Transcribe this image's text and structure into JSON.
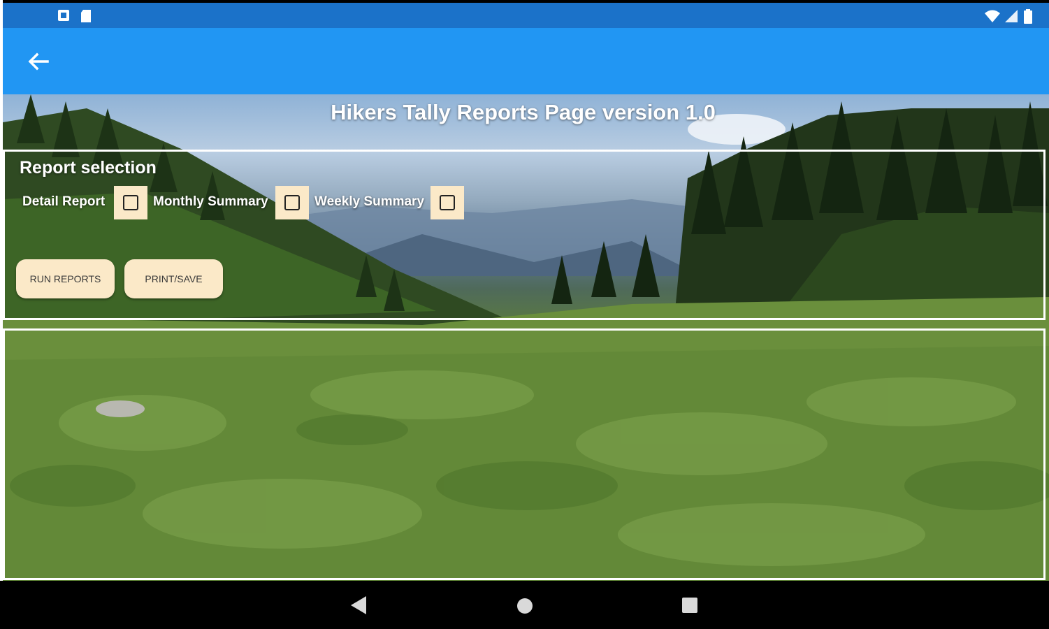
{
  "page": {
    "title": "Hikers Tally Reports Page version 1.0"
  },
  "report_selection": {
    "heading": "Report selection",
    "options": [
      {
        "label": "Detail Report",
        "checked": false
      },
      {
        "label": "Monthly Summary",
        "checked": false
      },
      {
        "label": "Weekly Summary",
        "checked": false
      }
    ]
  },
  "buttons": {
    "run_reports": "RUN REPORTS",
    "print_save": "PRINT/SAVE"
  },
  "icons": {
    "status_left": [
      "screenshot-icon",
      "sd-card-icon"
    ],
    "status_right": [
      "wifi-icon",
      "cell-signal-icon",
      "battery-icon"
    ],
    "app_bar": "back-arrow-icon",
    "nav": [
      "nav-back-icon",
      "nav-home-icon",
      "nav-recents-icon"
    ]
  },
  "colors": {
    "status_bar": "#1b72c9",
    "app_bar": "#2196f3",
    "button_fill": "#fbe9c8"
  }
}
